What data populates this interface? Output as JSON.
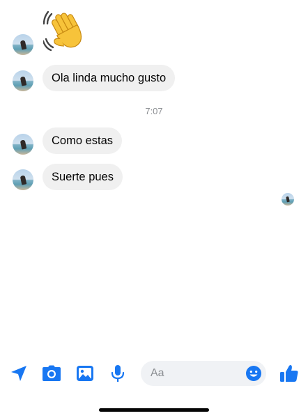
{
  "messages": [
    {
      "kind": "emoji",
      "emoji_name": "waving-hand"
    },
    {
      "kind": "text",
      "text": "Ola linda mucho gusto"
    },
    {
      "kind": "timestamp",
      "text": "7:07"
    },
    {
      "kind": "text",
      "text": "Como estas"
    },
    {
      "kind": "text",
      "text": "Suerte pues"
    }
  ],
  "composer": {
    "placeholder": "Aa",
    "icons": [
      "send-location-icon",
      "camera-icon",
      "gallery-icon",
      "microphone-icon",
      "emoji-icon",
      "like-icon"
    ]
  },
  "colors": {
    "accent": "#1877f2",
    "bubble": "#f0f0f0",
    "input_bg": "#f0f2f5",
    "timestamp": "#8a8d91"
  }
}
